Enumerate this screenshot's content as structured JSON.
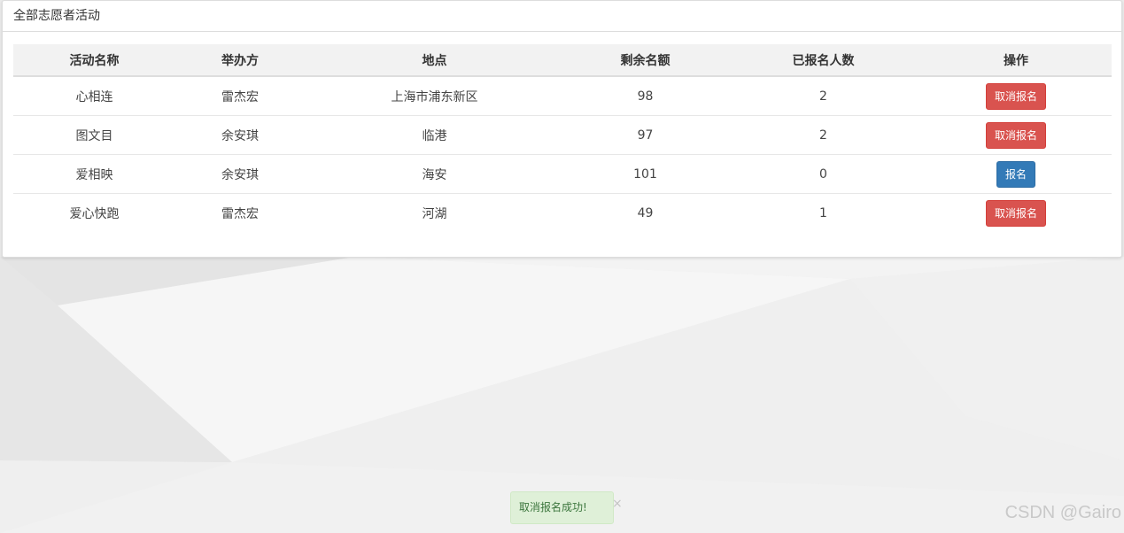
{
  "panel": {
    "title": "全部志愿者活动"
  },
  "table": {
    "headers": [
      "活动名称",
      "举办方",
      "地点",
      "剩余名额",
      "已报名人数",
      "操作"
    ],
    "rows": [
      {
        "name": "心相连",
        "organizer": "雷杰宏",
        "location": "上海市浦东新区",
        "remaining": "98",
        "enrolled": "2",
        "action": "取消报名",
        "action_type": "cancel"
      },
      {
        "name": "图文目",
        "organizer": "余安琪",
        "location": "临港",
        "remaining": "97",
        "enrolled": "2",
        "action": "取消报名",
        "action_type": "cancel"
      },
      {
        "name": "爱相映",
        "organizer": "余安琪",
        "location": "海安",
        "remaining": "101",
        "enrolled": "0",
        "action": "报名",
        "action_type": "signup"
      },
      {
        "name": "爱心快跑",
        "organizer": "雷杰宏",
        "location": "河湖",
        "remaining": "49",
        "enrolled": "1",
        "action": "取消报名",
        "action_type": "cancel"
      }
    ]
  },
  "toast": {
    "message": "取消报名成功!",
    "close": "×"
  },
  "watermark": "CSDN @Gairo",
  "colors": {
    "cancel_button": "#d9534f",
    "signup_button": "#337ab7",
    "toast_bg": "#dff0d8",
    "toast_text": "#3c763d"
  }
}
